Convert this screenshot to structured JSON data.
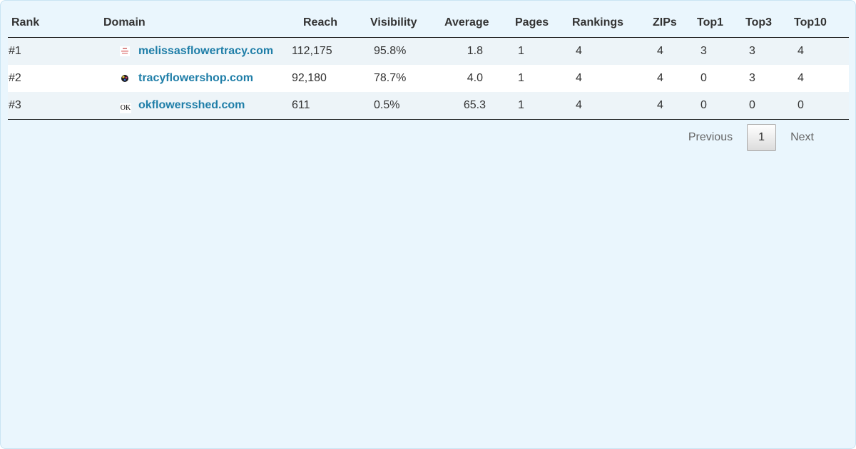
{
  "table": {
    "headers": [
      "Rank",
      "Domain",
      "Reach",
      "Visibility",
      "Average",
      "Pages",
      "Rankings",
      "ZIPs",
      "Top1",
      "Top3",
      "Top10"
    ],
    "rows": [
      {
        "rank": "#1",
        "favicon": "melissa-favicon",
        "domain": "melissasflowertracy.com",
        "reach": "112,175",
        "visibility": "95.8%",
        "average": "1.8",
        "pages": "1",
        "rankings": "4",
        "zips": "4",
        "top1": "3",
        "top3": "3",
        "top10": "4"
      },
      {
        "rank": "#2",
        "favicon": "tracy-favicon",
        "domain": "tracyflowershop.com",
        "reach": "92,180",
        "visibility": "78.7%",
        "average": "4.0",
        "pages": "1",
        "rankings": "4",
        "zips": "4",
        "top1": "0",
        "top3": "3",
        "top10": "4"
      },
      {
        "rank": "#3",
        "favicon": "ok-favicon",
        "favicon_text": "OK",
        "domain": "okflowersshed.com",
        "reach": "611",
        "visibility": "0.5%",
        "average": "65.3",
        "pages": "1",
        "rankings": "4",
        "zips": "4",
        "top1": "0",
        "top3": "0",
        "top10": "0"
      }
    ]
  },
  "pagination": {
    "previous_label": "Previous",
    "current_page": "1",
    "next_label": "Next"
  }
}
